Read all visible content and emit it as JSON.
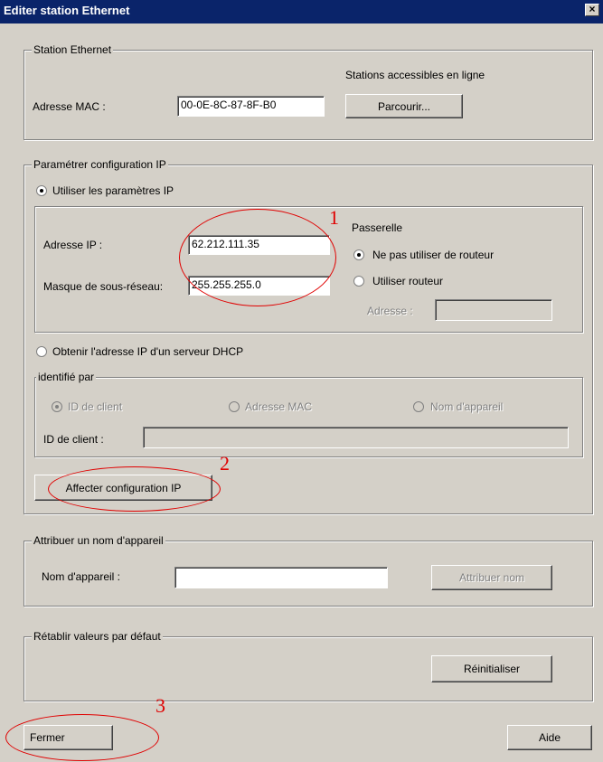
{
  "window": {
    "title": "Editer station Ethernet",
    "close_glyph": "×"
  },
  "station": {
    "group_label": "Station Ethernet",
    "online_label": "Stations accessibles en ligne",
    "mac_label": "Adresse MAC :",
    "mac_value": "00-0E-8C-87-8F-B0",
    "browse_button": "Parcourir..."
  },
  "ipconfig": {
    "group_label": "Paramétrer configuration IP",
    "use_ip_label": "Utiliser les paramètres IP",
    "ip_label": "Adresse IP :",
    "ip_value": "62.212.111.35",
    "mask_label": "Masque de sous-réseau:",
    "mask_value": "255.255.255.0",
    "gateway_label": "Passerelle",
    "no_router_label": "Ne pas utiliser de routeur",
    "use_router_label": "Utiliser routeur",
    "router_address_label": "Adresse :",
    "dhcp_label": "Obtenir l'adresse IP d'un serveur DHCP",
    "identified_label": "identifié par",
    "client_id_option": "ID de client",
    "mac_option": "Adresse MAC",
    "device_name_option": "Nom d'appareil",
    "client_id_label": "ID de client :",
    "assign_button": "Affecter configuration IP"
  },
  "device_name": {
    "group_label": "Attribuer un nom d'appareil",
    "name_label": "Nom d'appareil :",
    "assign_button": "Attribuer nom"
  },
  "reset": {
    "group_label": "Rétablir valeurs par défaut",
    "reset_button": "Réinitialiser"
  },
  "footer": {
    "close_button": "Fermer",
    "help_button": "Aide"
  },
  "annotations": {
    "one": "1",
    "two": "2",
    "three": "3",
    "color": "#e00000"
  }
}
